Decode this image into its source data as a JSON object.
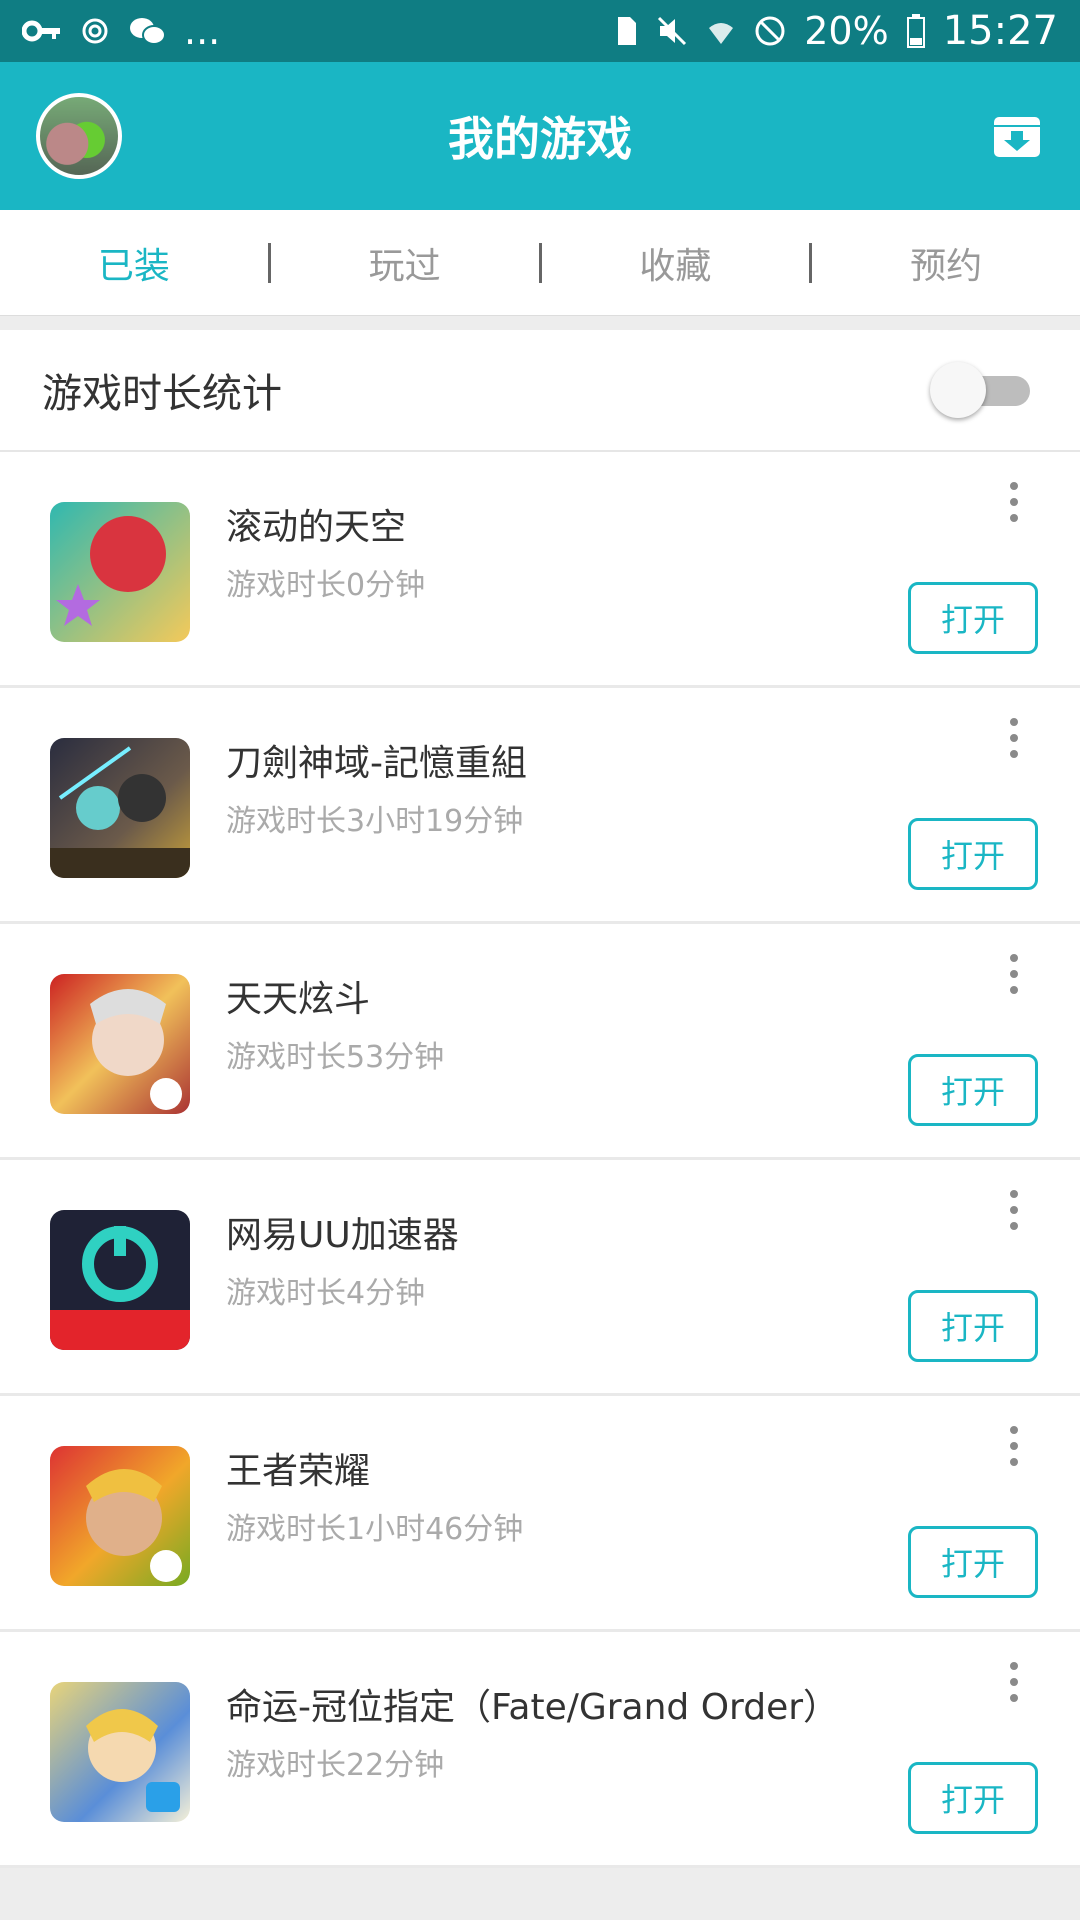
{
  "status_bar": {
    "icons_left": [
      "key-icon",
      "sync-icon",
      "wechat-icon",
      "more-notifications-icon"
    ],
    "more_text": "...",
    "icons_right": [
      "sim-icon",
      "mute-icon",
      "wifi-icon",
      "do-not-disturb-icon"
    ],
    "battery_percent": "20%",
    "time": "15:27"
  },
  "app_bar": {
    "title": "我的游戏",
    "avatar_icon": "avatar-icon",
    "action_icon": "download-box-icon"
  },
  "tabs": [
    {
      "label": "已装",
      "active": true
    },
    {
      "label": "玩过",
      "active": false
    },
    {
      "label": "收藏",
      "active": false
    },
    {
      "label": "预约",
      "active": false
    }
  ],
  "stats_toggle": {
    "label": "游戏时长统计",
    "on": false
  },
  "games": [
    {
      "name": "滚动的天空",
      "time": "游戏时长0分钟",
      "button": "打开",
      "icon": "rolling-sky-icon"
    },
    {
      "name": "刀劍神域-記憶重組",
      "time": "游戏时长3小时19分钟",
      "button": "打开",
      "icon": "sword-art-online-icon"
    },
    {
      "name": "天天炫斗",
      "time": "游戏时长53分钟",
      "button": "打开",
      "icon": "tiantian-xuandou-icon"
    },
    {
      "name": "网易UU加速器",
      "time": "游戏时长4分钟",
      "button": "打开",
      "icon": "uu-accelerator-icon"
    },
    {
      "name": "王者荣耀",
      "time": "游戏时长1小时46分钟",
      "button": "打开",
      "icon": "honor-of-kings-icon"
    },
    {
      "name": "命运-冠位指定（Fate/Grand Order）",
      "time": "游戏时长22分钟",
      "button": "打开",
      "icon": "fate-grand-order-icon"
    }
  ],
  "colors": {
    "accent": "#1ab6c4",
    "status_bar": "#0f7d83"
  }
}
